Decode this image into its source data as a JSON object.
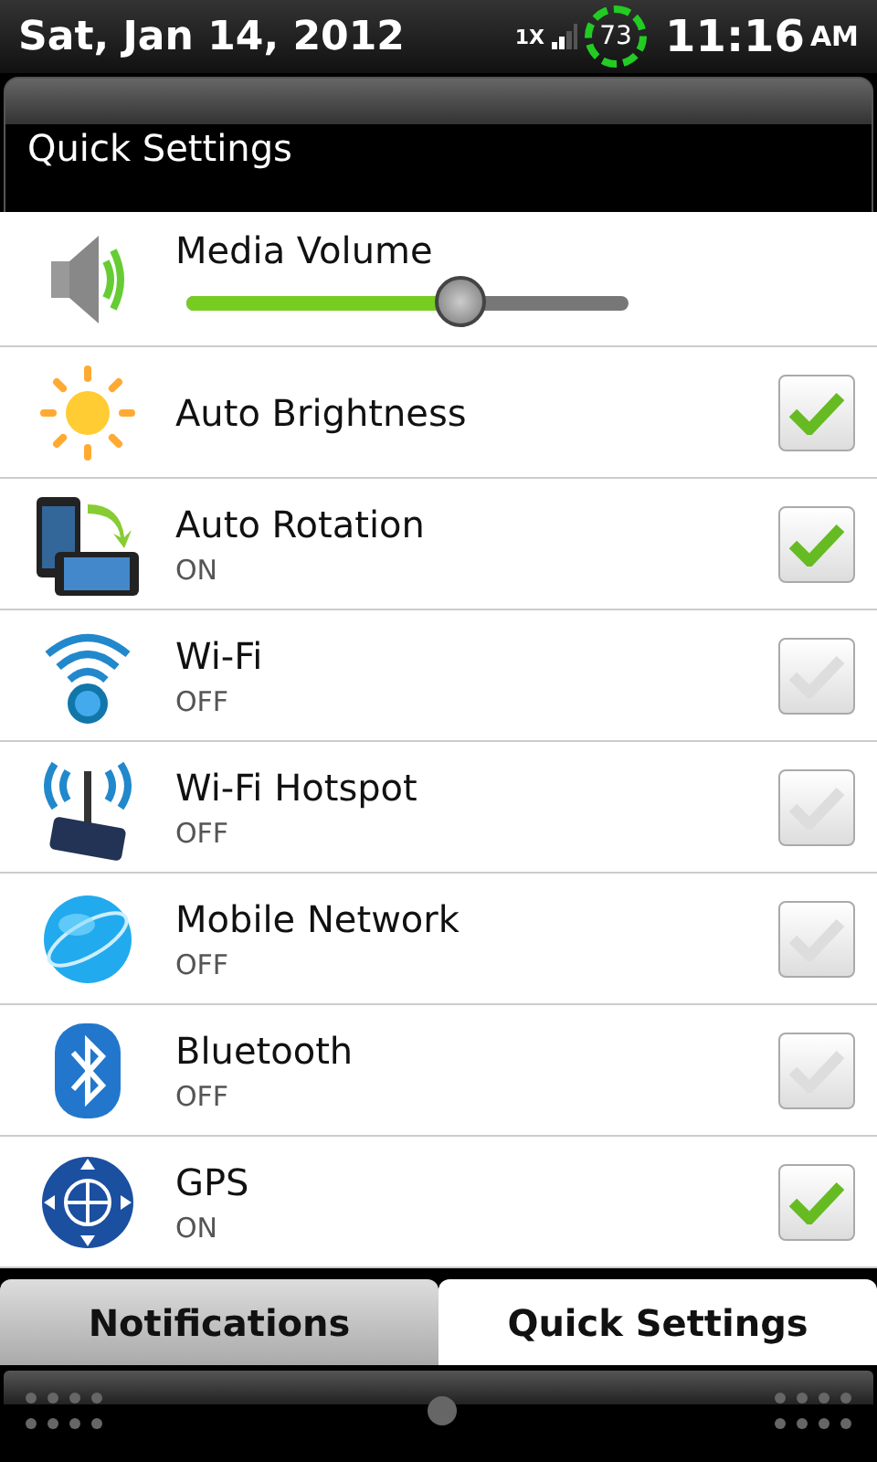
{
  "status_bar": {
    "date": "Sat, Jan 14, 2012",
    "network": "1X",
    "battery": "73",
    "time": "11:16",
    "ampm": "AM"
  },
  "header": {
    "title": "Quick Settings"
  },
  "settings": [
    {
      "kind": "slider",
      "label": "Media Volume",
      "level": 0.62
    },
    {
      "kind": "toggle",
      "label": "Auto Brightness",
      "checked": true
    },
    {
      "kind": "toggle",
      "label": "Auto Rotation",
      "status": "ON",
      "checked": true
    },
    {
      "kind": "toggle",
      "label": "Wi-Fi",
      "status": "OFF",
      "checked": false
    },
    {
      "kind": "toggle",
      "label": "Wi-Fi Hotspot",
      "status": "OFF",
      "checked": false
    },
    {
      "kind": "toggle",
      "label": "Mobile Network",
      "status": "OFF",
      "checked": false
    },
    {
      "kind": "toggle",
      "label": "Bluetooth",
      "status": "OFF",
      "checked": false
    },
    {
      "kind": "toggle",
      "label": "GPS",
      "status": "ON",
      "checked": true
    }
  ],
  "tabs": [
    {
      "label": "Notifications",
      "selected": false
    },
    {
      "label": "Quick Settings",
      "selected": true
    }
  ]
}
